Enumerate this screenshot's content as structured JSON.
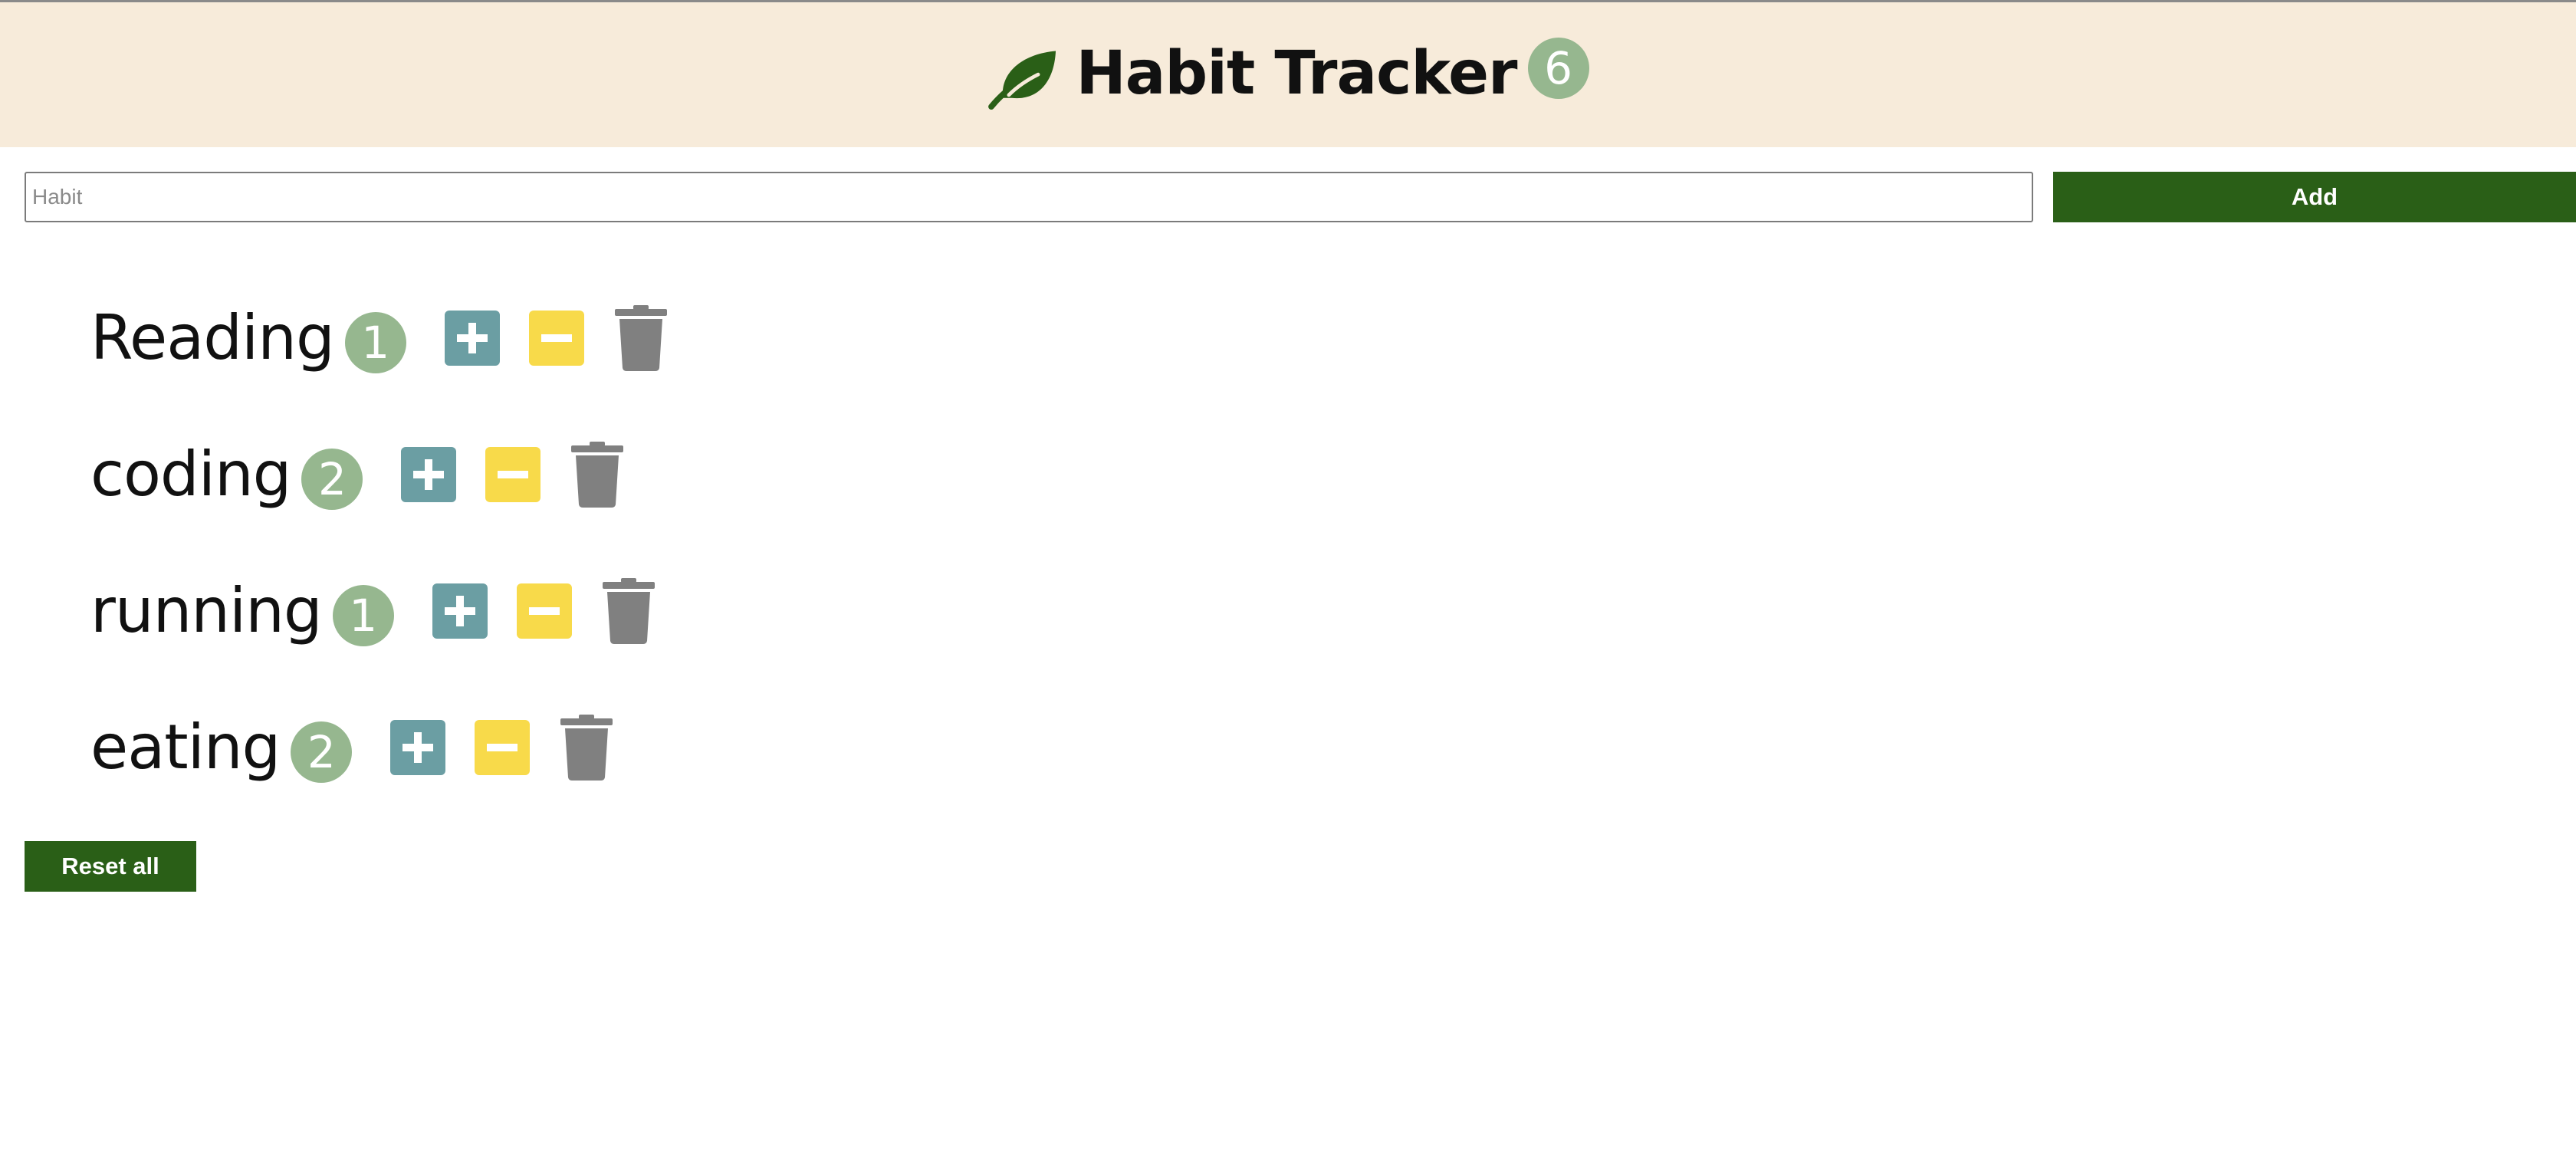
{
  "header": {
    "title": "Habit Tracker",
    "total_count": "6",
    "icon": "leaf-icon"
  },
  "form": {
    "input_placeholder": "Habit",
    "input_value": "",
    "add_label": "Add"
  },
  "habits": [
    {
      "name": "Reading",
      "count": "1"
    },
    {
      "name": "coding",
      "count": "2"
    },
    {
      "name": "running",
      "count": "1"
    },
    {
      "name": "eating",
      "count": "2"
    }
  ],
  "controls": {
    "increment_icon": "plus-icon",
    "decrement_icon": "minus-icon",
    "delete_icon": "trash-icon"
  },
  "footer": {
    "reset_label": "Reset all"
  },
  "colors": {
    "header_bg": "#f7ebda",
    "accent_green": "#2a5f17",
    "badge_green": "#96b78f",
    "plus_teal": "#6b9ea3",
    "minus_yellow": "#f8da4a",
    "trash_gray": "#808080"
  }
}
